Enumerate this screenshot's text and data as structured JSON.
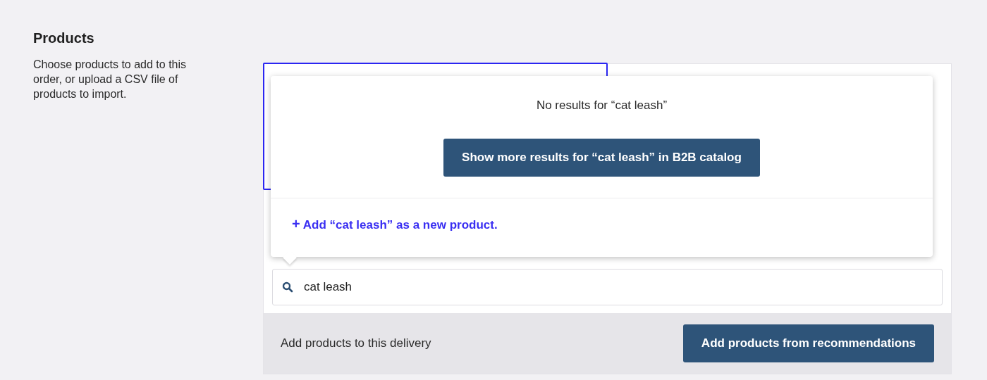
{
  "section": {
    "title": "Products",
    "description": "Choose products to add to this order, or upload a CSV file of products to import."
  },
  "dropdown": {
    "message": "No results for “cat leash”",
    "more_button": "Show more results for “cat leash” in B2B catalog",
    "add_icon": "+",
    "add_link": "Add “cat leash” as a new product."
  },
  "search": {
    "value": "cat leash"
  },
  "footer": {
    "label": "Add products to this delivery",
    "button": "Add products from recommendations"
  }
}
